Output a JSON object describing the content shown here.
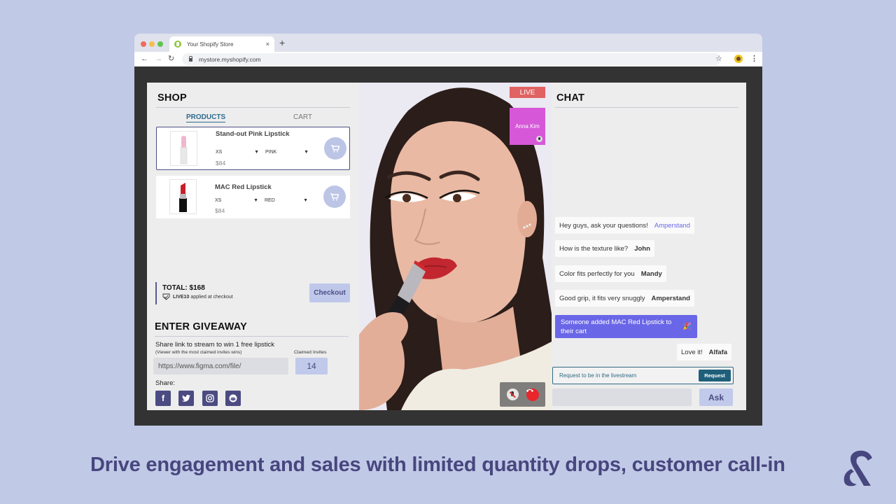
{
  "browser": {
    "tab_title": "Your Shopify Store",
    "tab_close": "×",
    "new_tab": "+",
    "url": "mystore.myshopify.com",
    "back": "←",
    "forward": "→",
    "reload": "↻",
    "bookmark": "☆",
    "menu": "⋮"
  },
  "shop": {
    "title": "SHOP",
    "tabs": [
      {
        "label": "PRODUCTS",
        "active": true
      },
      {
        "label": "CART",
        "active": false
      }
    ],
    "products": [
      {
        "name": "Stand-out Pink Lipstick",
        "size": "XS",
        "color": "PINK",
        "price": "$84",
        "selected": true,
        "swatch": "#f0b6cf"
      },
      {
        "name": "MAC Red Lipstick",
        "size": "XS",
        "color": "RED",
        "price": "$84",
        "selected": false,
        "swatch": "#c8202b"
      }
    ],
    "total": "TOTAL:  $168",
    "promo_code": "LIVE10",
    "promo_text": "applied at checkout",
    "checkout_label": "Checkout"
  },
  "giveaway": {
    "title": "ENTER GIVEAWAY",
    "description": "Share link to stream to win 1 free lipstick",
    "subtext": "(Viewer with the most claimed invites wins)",
    "link_value": "https://www.figma.com/file/",
    "claimed_label": "Claimed Invites",
    "claimed_count": "14",
    "share_label": "Share:",
    "social": [
      "facebook",
      "twitter",
      "instagram",
      "reddit"
    ]
  },
  "video": {
    "live_label": "LIVE",
    "guest_name": "Anna Kim",
    "hangup_glyph": "☎"
  },
  "chat": {
    "title": "CHAT",
    "messages": [
      {
        "text": "Hey guys, ask your questions!",
        "author": "Amperstand"
      },
      {
        "text": "How is the texture like?",
        "author": "John"
      },
      {
        "text": "Color fits perfectly for you",
        "author": "Mandy"
      },
      {
        "text": "Good grip, it fits very snuggly",
        "author": "Amperstand"
      },
      {
        "text": "Love it!",
        "author": "Alfafa"
      }
    ],
    "notice": "Someone added MAC Red Lipstick to their cart",
    "notice_icon": "🎉",
    "request_placeholder": "Request to be in the livestream",
    "request_label": "Request",
    "ask_placeholder": "",
    "ask_label": "Ask"
  },
  "caption": "Drive engagement and sales with limited quantity drops, customer call-in",
  "colors": {
    "background": "#c0c9e6",
    "brand": "#47467e",
    "accent": "#6a66e8",
    "live": "#e06262"
  }
}
